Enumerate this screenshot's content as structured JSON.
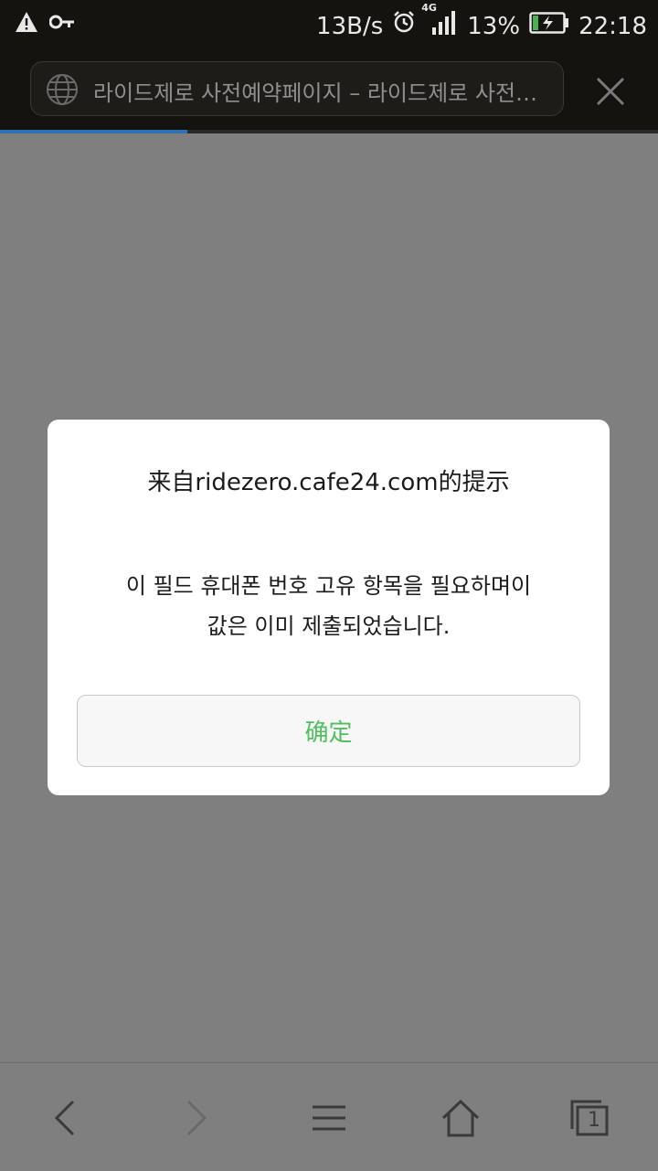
{
  "status_bar": {
    "network_speed": "13B/s",
    "network_type": "4G",
    "battery_percent": "13%",
    "time": "22:18",
    "icons": [
      "warning-icon",
      "key-icon",
      "alarm-icon",
      "signal-icon",
      "battery-charging-icon"
    ]
  },
  "browser": {
    "url_title": "라이드제로 사전예약페이지 – 라이드제로 사전예약페이지",
    "page_load_progress": 0.285
  },
  "dialog": {
    "title": "来自ridezero.cafe24.com的提示",
    "message": "이 필드 휴대폰 번호 고유 항목을 필요하며이\n값은 이미 제출되었습니다.",
    "ok_label": "确定"
  },
  "bottom_nav": {
    "tab_count": "1",
    "icons": [
      "back-icon",
      "forward-icon",
      "menu-icon",
      "home-icon",
      "tabs-icon"
    ]
  },
  "colors": {
    "button_text": "#4fbf5f",
    "progress": "#2f6fb3"
  }
}
